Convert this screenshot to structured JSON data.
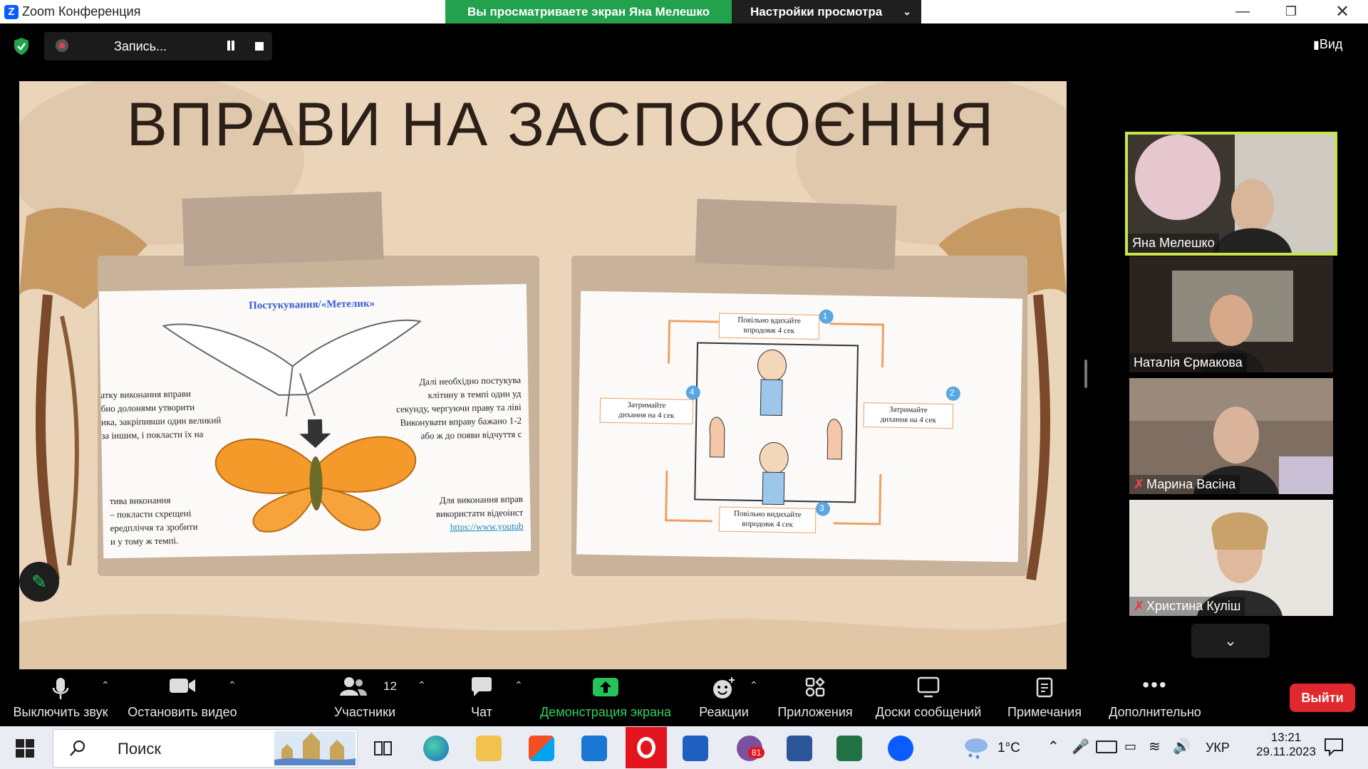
{
  "titlebar": {
    "app_title": "Zoom Конференция",
    "logo": "Z",
    "icons": [
      "minimize-icon",
      "restore-icon",
      "close-icon"
    ]
  },
  "view_banner": {
    "status": "Вы просматриваете экран Яна Мелешко",
    "settings": "Настройки просмотра"
  },
  "recording": {
    "label": "Запись..."
  },
  "view_button": {
    "label": "Вид"
  },
  "slide": {
    "title": "ВПРАВИ НА ЗАСПОКОЄННЯ",
    "left_card": {
      "heading": "Постукування/«Метелик»",
      "text_left_1": [
        "атку виконання вправи",
        "бно долонями утворити",
        "ика, закріпивши один великий",
        "за іншим, і покласти їх на"
      ],
      "text_left_2": [
        "тива виконання",
        "– покласти схрещені",
        "ередпліччя та зробити",
        "и у тому ж темпі."
      ],
      "text_right_1": [
        "Далі необхідно постукува",
        "клітину в темпі один уд",
        "секунду, чергуючи праву та ліві",
        "Виконувати вправу бажано 1-2",
        "або ж до появи відчуття с"
      ],
      "text_right_2": [
        "Для виконання вправ",
        "використати відеоінст"
      ],
      "link": "https://www.youtub"
    },
    "right_card": {
      "step1": [
        "Повільно вдихайте",
        "впродовж 4 сек"
      ],
      "step2": [
        "Затримайте",
        "дихання на 4 сек"
      ],
      "step3": [
        "Повільно видихайте",
        "впродовж 4 сек"
      ],
      "step4": [
        "Затримайте",
        "дихання на 4 сек"
      ],
      "numbers": [
        "1",
        "2",
        "3",
        "4"
      ]
    }
  },
  "participants": [
    {
      "name": "Яна Мелешко",
      "muted": false,
      "active": true
    },
    {
      "name": "Наталія  Єрмакова",
      "muted": false,
      "active": false
    },
    {
      "name": "Марина Васіна",
      "muted": true,
      "active": false
    },
    {
      "name": "Христина Куліш",
      "muted": true,
      "active": false
    }
  ],
  "toolbar": {
    "mute": "Выключить звук",
    "video": "Остановить видео",
    "participants": "Участники",
    "participants_count": "12",
    "chat": "Чат",
    "share": "Демонстрация экрана",
    "reactions": "Реакции",
    "apps": "Приложения",
    "whiteboards": "Доски сообщений",
    "notes": "Примечания",
    "more": "Дополнительно",
    "leave": "Выйти"
  },
  "taskbar": {
    "search_placeholder": "Поиск",
    "weather": "1°C",
    "language": "УКР",
    "time": "13:21",
    "date": "29.11.2023",
    "viber_badge": "81"
  },
  "colors": {
    "share_green": "#23a24d",
    "leave_red": "#e0282e",
    "active_speaker": "#c8e64a",
    "zoom_blue": "#0b5cff"
  }
}
